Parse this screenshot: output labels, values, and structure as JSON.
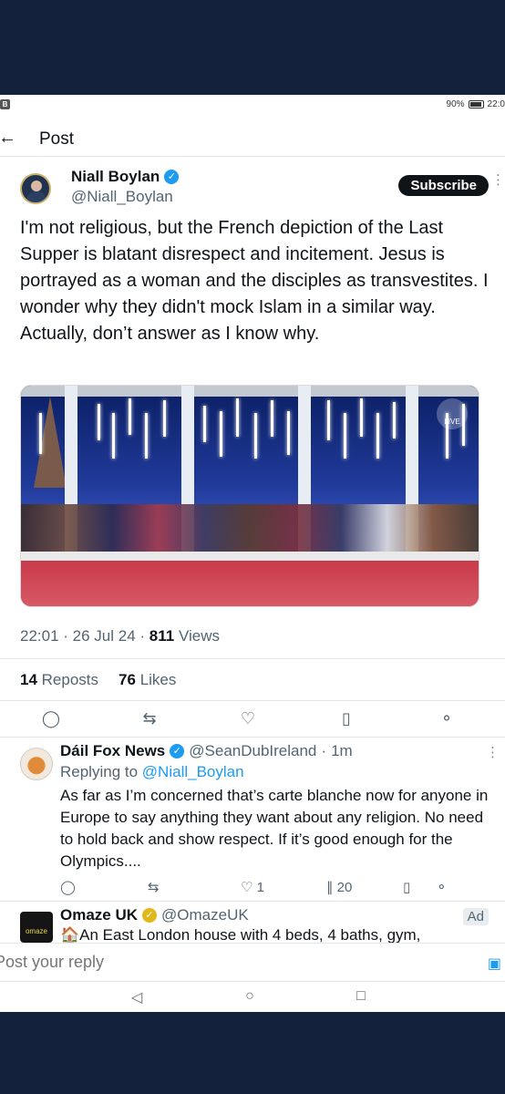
{
  "status": {
    "battery": "90%",
    "time": "22:0"
  },
  "header": {
    "title": "Post"
  },
  "tweet": {
    "author_name": "Niall Boylan",
    "author_handle": "@Niall_Boylan",
    "subscribe_label": "Subscribe",
    "text": "I'm not religious, but the French depiction of the Last Supper is blatant disrespect and incitement. Jesus is portrayed as a woman and the disciples as transvestites. I wonder why they didn't mock Islam in a similar way. Actually, don’t answer as  I know why.",
    "media_badge": "LIVE",
    "time": "22:01",
    "date": "26 Jul 24",
    "views_count": "811",
    "views_label": "Views",
    "reposts_count": "14",
    "reposts_label": "Reposts",
    "likes_count": "76",
    "likes_label": "Likes"
  },
  "reply": {
    "author_name": "Dáil Fox News",
    "author_handle": "@SeanDubIreland",
    "time_ago": "1m",
    "replying_to_label": "Replying to",
    "replying_to_handle": "@Niall_Boylan",
    "text": "As far as I’m concerned that’s carte blanche now for anyone in Europe to say anything they want about any religion. No need to hold back and show respect. If it’s good enough for the Olympics....",
    "likes": "1",
    "views": "20"
  },
  "ad": {
    "logo_text": "omaze",
    "author_name": "Omaze UK",
    "author_handle": "@OmazeUK",
    "badge": "Ad",
    "text": "🏠An East London house with 4 beds, 4 baths, gym,"
  },
  "composer": {
    "placeholder": "Post your reply"
  },
  "icons": {
    "back": "back-arrow-icon",
    "verified": "verified-badge-icon",
    "reply": "comment-icon",
    "repost": "repost-icon",
    "like": "heart-icon",
    "bookmark": "bookmark-icon",
    "share": "share-icon",
    "camera": "camera-icon"
  },
  "colors": {
    "accent": "#1d9bf0",
    "text": "#0f1419",
    "muted": "#536471",
    "background": "#14213d"
  }
}
